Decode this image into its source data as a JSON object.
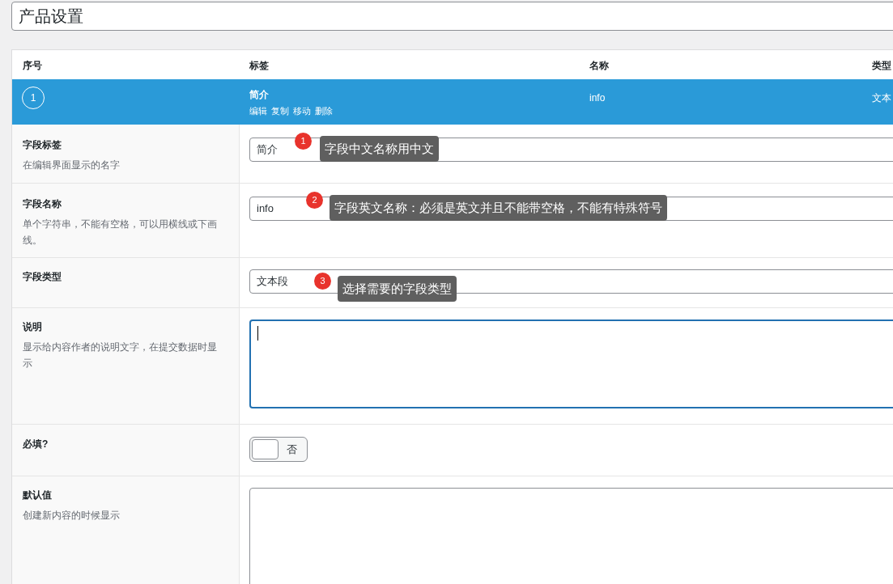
{
  "title_field": {
    "value": "产品设置"
  },
  "table": {
    "columns": [
      "序号",
      "标签",
      "名称",
      "类型"
    ],
    "rows": [
      {
        "number": "1",
        "label": "简介",
        "actions": [
          "编辑",
          "复制",
          "移动",
          "删除"
        ],
        "name": "info",
        "type": "文本",
        "selected": true
      }
    ]
  },
  "fields": [
    {
      "kind": "text",
      "label": "字段标签",
      "description": "在编辑界面显示的名字",
      "value": "简介",
      "tip": {
        "number": "1",
        "text": "字段中文名称用中文"
      }
    },
    {
      "kind": "text",
      "label": "字段名称",
      "description": "单个字符串，不能有空格，可以用横线或下画线。",
      "value": "info",
      "tip": {
        "number": "2",
        "text": "字段英文名称：必须是英文并且不能带空格，不能有特殊符号"
      }
    },
    {
      "kind": "select",
      "label": "字段类型",
      "value": "文本段",
      "tip": {
        "number": "3",
        "text": "选择需要的字段类型"
      }
    },
    {
      "kind": "textarea",
      "label": "说明",
      "description": "显示给内容作者的说明文字，在提交数据时显示",
      "focused": true
    },
    {
      "kind": "toggle",
      "label": "必填?",
      "on": false,
      "state_text": "否"
    },
    {
      "kind": "textarea",
      "label": "默认值",
      "description": "创建新内容的时候显示",
      "focused": false
    }
  ]
}
